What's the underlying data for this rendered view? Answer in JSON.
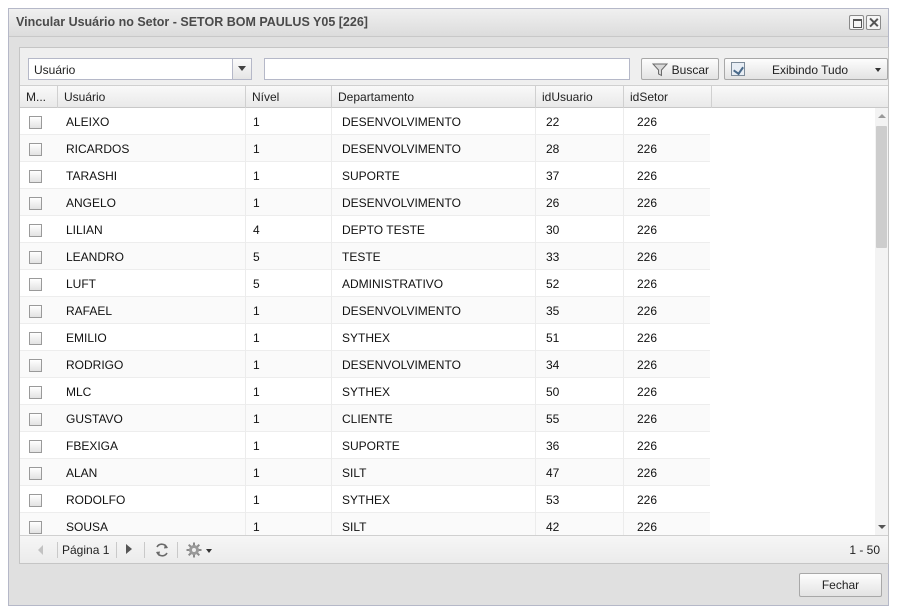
{
  "window": {
    "title": "Vincular Usuário no Setor - SETOR BOM PAULUS Y05 [226]"
  },
  "toolbar": {
    "field_select": "Usuário",
    "search_value": "",
    "search_placeholder": "",
    "search_button": "Buscar",
    "show_all_button": "Exibindo Tudo"
  },
  "grid": {
    "columns": [
      "M...",
      "Usuário",
      "Nível",
      "Departamento",
      "idUsuario",
      "idSetor"
    ],
    "rows": [
      {
        "usuario": "ALEIXO",
        "nivel": "1",
        "departamento": "DESENVOLVIMENTO",
        "idUsuario": "22",
        "idSetor": "226"
      },
      {
        "usuario": "RICARDOS",
        "nivel": "1",
        "departamento": "DESENVOLVIMENTO",
        "idUsuario": "28",
        "idSetor": "226"
      },
      {
        "usuario": "TARASHI",
        "nivel": "1",
        "departamento": "SUPORTE",
        "idUsuario": "37",
        "idSetor": "226"
      },
      {
        "usuario": "ANGELO",
        "nivel": "1",
        "departamento": "DESENVOLVIMENTO",
        "idUsuario": "26",
        "idSetor": "226"
      },
      {
        "usuario": "LILIAN",
        "nivel": "4",
        "departamento": "DEPTO TESTE",
        "idUsuario": "30",
        "idSetor": "226"
      },
      {
        "usuario": "LEANDRO",
        "nivel": "5",
        "departamento": "TESTE",
        "idUsuario": "33",
        "idSetor": "226"
      },
      {
        "usuario": "LUFT",
        "nivel": "5",
        "departamento": "ADMINISTRATIVO",
        "idUsuario": "52",
        "idSetor": "226"
      },
      {
        "usuario": "RAFAEL",
        "nivel": "1",
        "departamento": "DESENVOLVIMENTO",
        "idUsuario": "35",
        "idSetor": "226"
      },
      {
        "usuario": "EMILIO",
        "nivel": "1",
        "departamento": "SYTHEX",
        "idUsuario": "51",
        "idSetor": "226"
      },
      {
        "usuario": "RODRIGO",
        "nivel": "1",
        "departamento": "DESENVOLVIMENTO",
        "idUsuario": "34",
        "idSetor": "226"
      },
      {
        "usuario": "MLC",
        "nivel": "1",
        "departamento": "SYTHEX",
        "idUsuario": "50",
        "idSetor": "226"
      },
      {
        "usuario": "GUSTAVO",
        "nivel": "1",
        "departamento": "CLIENTE",
        "idUsuario": "55",
        "idSetor": "226"
      },
      {
        "usuario": "FBEXIGA",
        "nivel": "1",
        "departamento": "SUPORTE",
        "idUsuario": "36",
        "idSetor": "226"
      },
      {
        "usuario": "ALAN",
        "nivel": "1",
        "departamento": "SILT",
        "idUsuario": "47",
        "idSetor": "226"
      },
      {
        "usuario": "RODOLFO",
        "nivel": "1",
        "departamento": "SYTHEX",
        "idUsuario": "53",
        "idSetor": "226"
      },
      {
        "usuario": "SOUSA",
        "nivel": "1",
        "departamento": "SILT",
        "idUsuario": "42",
        "idSetor": "226"
      }
    ]
  },
  "paging": {
    "page_label": "Página 1",
    "range": "1 - 50"
  },
  "footer": {
    "close_button": "Fechar"
  }
}
